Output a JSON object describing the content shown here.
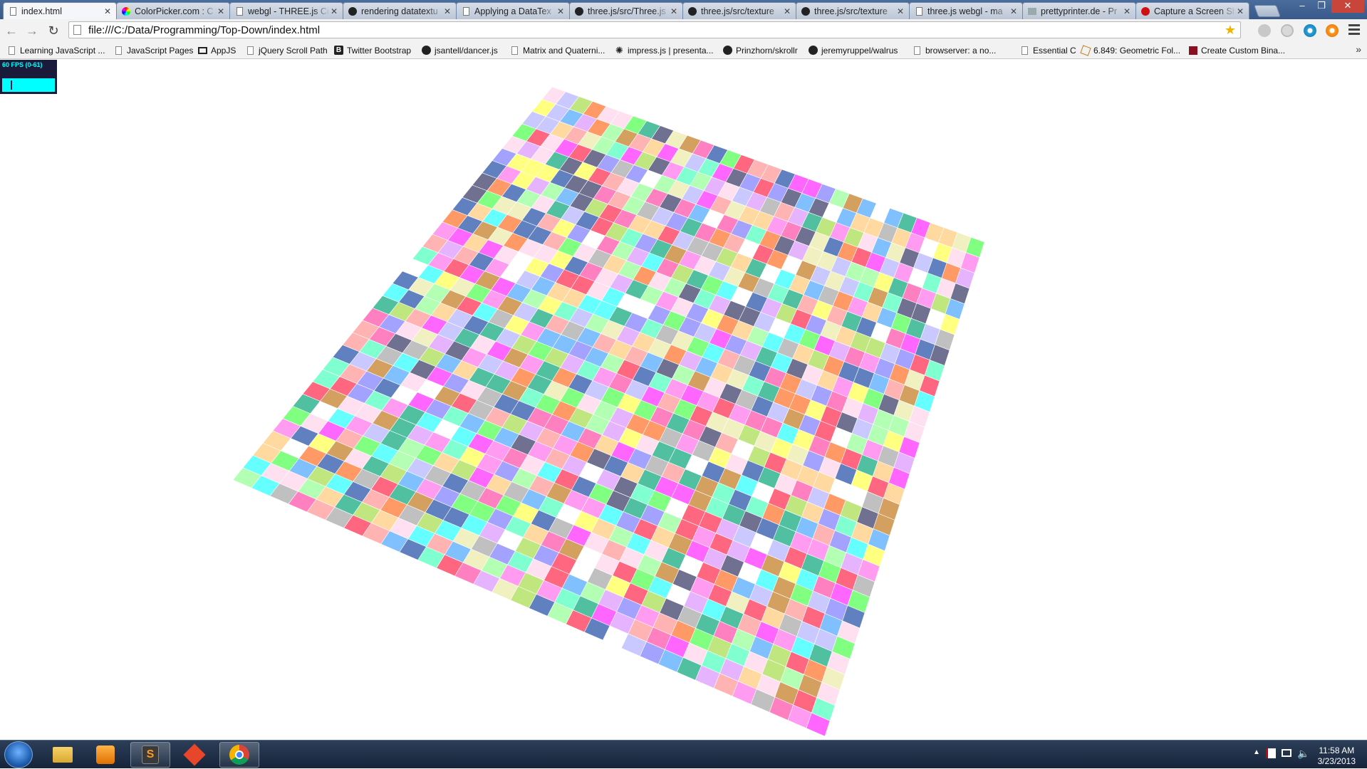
{
  "browser": {
    "tabs": [
      {
        "title": "index.html",
        "active": true,
        "icon": "page-icon"
      },
      {
        "title": "ColorPicker.com : C",
        "active": false,
        "icon": "colorpicker-icon"
      },
      {
        "title": "webgl - THREE.js Ci",
        "active": false,
        "icon": "page-icon"
      },
      {
        "title": "rendering datatextu",
        "active": false,
        "icon": "github-icon"
      },
      {
        "title": "Applying a DataTex",
        "active": false,
        "icon": "page-icon"
      },
      {
        "title": "three.js/src/Three.js",
        "active": false,
        "icon": "github-icon"
      },
      {
        "title": "three.js/src/texture",
        "active": false,
        "icon": "github-icon"
      },
      {
        "title": "three.js/src/texture",
        "active": false,
        "icon": "github-icon"
      },
      {
        "title": "three.js webgl - ma",
        "active": false,
        "icon": "page-icon"
      },
      {
        "title": "prettyprinter.de - Pr",
        "active": false,
        "icon": "prettyprinter-icon"
      },
      {
        "title": "Capture a Screen Sh",
        "active": false,
        "icon": "red-circle-icon"
      }
    ],
    "url": "file:///C:/Data/Programming/Top-Down/index.html",
    "bookmarks": [
      {
        "label": "Learning JavaScript ...",
        "icon": "doc-icon"
      },
      {
        "label": "JavaScript Pages",
        "icon": "doc-icon"
      },
      {
        "label": "AppJS",
        "icon": "monitor-icon"
      },
      {
        "label": "jQuery Scroll Path",
        "icon": "doc-icon"
      },
      {
        "label": "Twitter Bootstrap",
        "icon": "bootstrap-icon"
      },
      {
        "label": "jsantell/dancer.js",
        "icon": "github-icon"
      },
      {
        "label": "Matrix and Quaterni...",
        "icon": "doc-icon"
      },
      {
        "label": "impress.js | presenta...",
        "icon": "star-burst-icon"
      },
      {
        "label": "Prinzhorn/skrollr",
        "icon": "github-icon"
      },
      {
        "label": "jeremyruppel/walrus",
        "icon": "github-icon"
      },
      {
        "label": "browserver: a no...",
        "icon": "doc-icon"
      },
      {
        "label": "Essential C",
        "icon": "doc-icon"
      },
      {
        "label": "6.849: Geometric Fol...",
        "icon": "fold-icon"
      },
      {
        "label": "Create Custom Bina...",
        "icon": "red-square-icon"
      }
    ],
    "bookmarks_overflow": "»"
  },
  "stats": {
    "fps_label": "60 FPS (0-61)",
    "fps_color": "#00ffff",
    "panel_color": "#1a1a3a"
  },
  "scene": {
    "description_grid": "checker floor",
    "tile_palette": [
      "#ff9bf0",
      "#66ffff",
      "#a3a3ff",
      "#ffff80",
      "#80ff80",
      "#ffb3b3",
      "#ffffff",
      "#c9c9ff",
      "#ff80c0",
      "#80c0ff",
      "#ffd9a0",
      "#b3ffb3",
      "#e6b3ff",
      "#80ffd0",
      "#ff6680",
      "#c0e680",
      "#ffe0f0",
      "#707090",
      "#d4a060",
      "#6080c0",
      "#f0f0c0",
      "#ff66ff",
      "#50c0a0",
      "#c0c0c0",
      "#ff9966"
    ]
  },
  "taskbar": {
    "apps": [
      {
        "name": "explorer-icon",
        "running": false
      },
      {
        "name": "media-player-icon",
        "running": false
      },
      {
        "name": "sublime-text-icon",
        "running": true
      },
      {
        "name": "git-icon",
        "running": false
      },
      {
        "name": "chrome-icon",
        "running": true
      }
    ],
    "clock_time": "11:58 AM",
    "clock_date": "3/23/2013"
  }
}
